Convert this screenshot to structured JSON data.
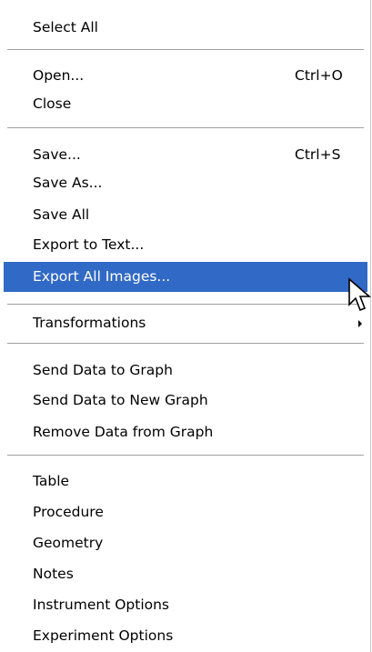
{
  "menu": {
    "items": [
      {
        "label": "Select All",
        "shortcut": ""
      },
      {
        "label": "Open...",
        "shortcut": "Ctrl+O"
      },
      {
        "label": "Close",
        "shortcut": ""
      },
      {
        "label": "Save...",
        "shortcut": "Ctrl+S"
      },
      {
        "label": "Save As...",
        "shortcut": ""
      },
      {
        "label": "Save All",
        "shortcut": ""
      },
      {
        "label": "Export to Text...",
        "shortcut": ""
      },
      {
        "label": "Export All Images...",
        "shortcut": ""
      },
      {
        "label": "Transformations",
        "shortcut": ""
      },
      {
        "label": "Send Data to Graph",
        "shortcut": ""
      },
      {
        "label": "Send Data to New Graph",
        "shortcut": ""
      },
      {
        "label": "Remove Data from Graph",
        "shortcut": ""
      },
      {
        "label": "Table",
        "shortcut": ""
      },
      {
        "label": "Procedure",
        "shortcut": ""
      },
      {
        "label": "Geometry",
        "shortcut": ""
      },
      {
        "label": "Notes",
        "shortcut": ""
      },
      {
        "label": "Instrument Options",
        "shortcut": ""
      },
      {
        "label": "Experiment Options",
        "shortcut": ""
      }
    ],
    "selected_item": "Export All Images...",
    "submenu_arrow_icon": "submenu-arrow-icon",
    "cursor_icon": "mouse-pointer-icon"
  },
  "colors": {
    "highlight": "#3169c6",
    "highlight_text": "#ffffff",
    "text": "#000000",
    "separator": "#a0a0a0",
    "background": "#ffffff"
  }
}
